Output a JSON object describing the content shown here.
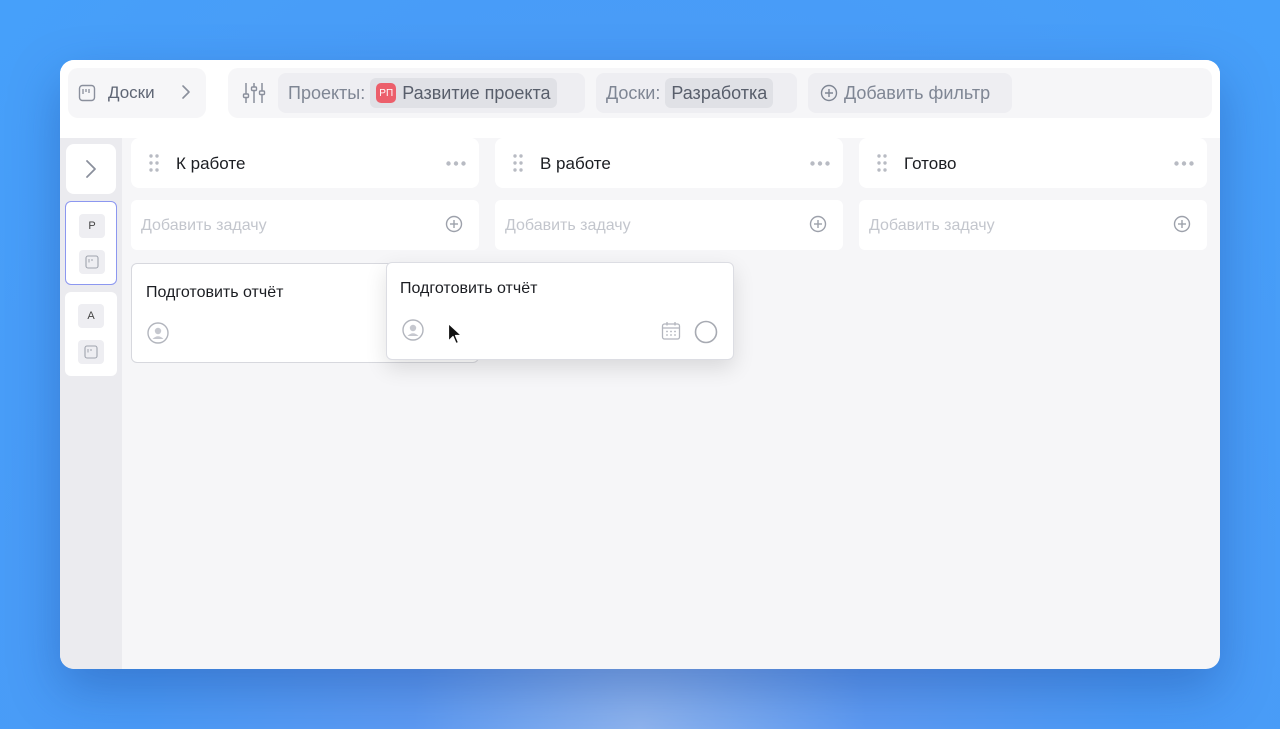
{
  "breadcrumb": {
    "label": "Доски",
    "icon": "board-icon"
  },
  "filters": {
    "projects_key": "Проекты:",
    "project_badge": "РП",
    "project_value": "Развитие проекта",
    "boards_key": "Доски:",
    "boards_value": "Разработка",
    "add_filter": "Добавить фильтр"
  },
  "sidebar": {
    "groups": [
      {
        "letter": "Р",
        "selected": true
      },
      {
        "letter": "А",
        "selected": false
      }
    ]
  },
  "columns": [
    {
      "title": "К работе",
      "add_placeholder": "Добавить задачу"
    },
    {
      "title": "В работе",
      "add_placeholder": "Добавить задачу"
    },
    {
      "title": "Готово",
      "add_placeholder": "Добавить задачу"
    }
  ],
  "card": {
    "title": "Подготовить отчёт"
  },
  "dragging_card": {
    "title": "Подготовить отчёт"
  },
  "colors": {
    "accent": "#8c97f0",
    "project_badge": "#ec5f6b",
    "background": "#4a9af6"
  }
}
